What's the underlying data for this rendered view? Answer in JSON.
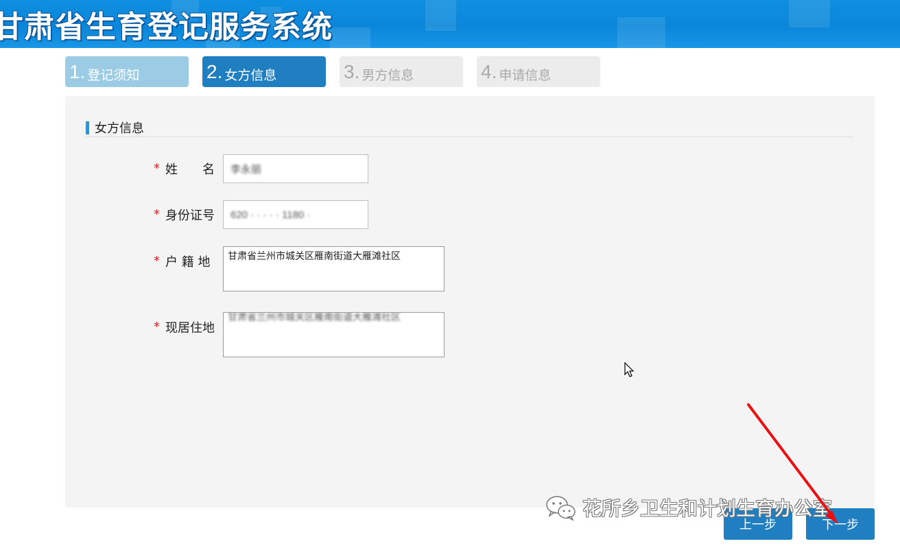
{
  "header": {
    "title": "甘肃省生育登记服务系统",
    "background_color": "#0a86da"
  },
  "steps": [
    {
      "num": "1.",
      "label": "登记须知",
      "state": "done"
    },
    {
      "num": "2.",
      "label": "女方信息",
      "state": "active"
    },
    {
      "num": "3.",
      "label": "男方信息",
      "state": "todo"
    },
    {
      "num": "4.",
      "label": "申请信息",
      "state": "todo"
    }
  ],
  "form": {
    "section_title": "女方信息",
    "required_mark": "*",
    "fields": {
      "name": {
        "label": "姓　　名",
        "value": "李永丽"
      },
      "id_number": {
        "label": "身份证号",
        "value": "620 · · · · · 1180 ·"
      },
      "household_registration": {
        "label": "户 籍 地",
        "value": "甘肃省兰州市城关区雁南街道大雁滩社区"
      },
      "current_residence": {
        "label": "现居住地",
        "value": "甘肃省兰州市城关区雁南街道大雁滩社区"
      }
    }
  },
  "buttons": {
    "prev": "上一步",
    "next": "下一步"
  },
  "watermark": {
    "text": "花所乡卫生和计划生育办公室",
    "icon": "wechat-icon"
  },
  "colors": {
    "primary": "#1f7fc0",
    "accent_bar": "#1a9be6",
    "required": "#e02020",
    "annotation_arrow": "#e81010"
  }
}
